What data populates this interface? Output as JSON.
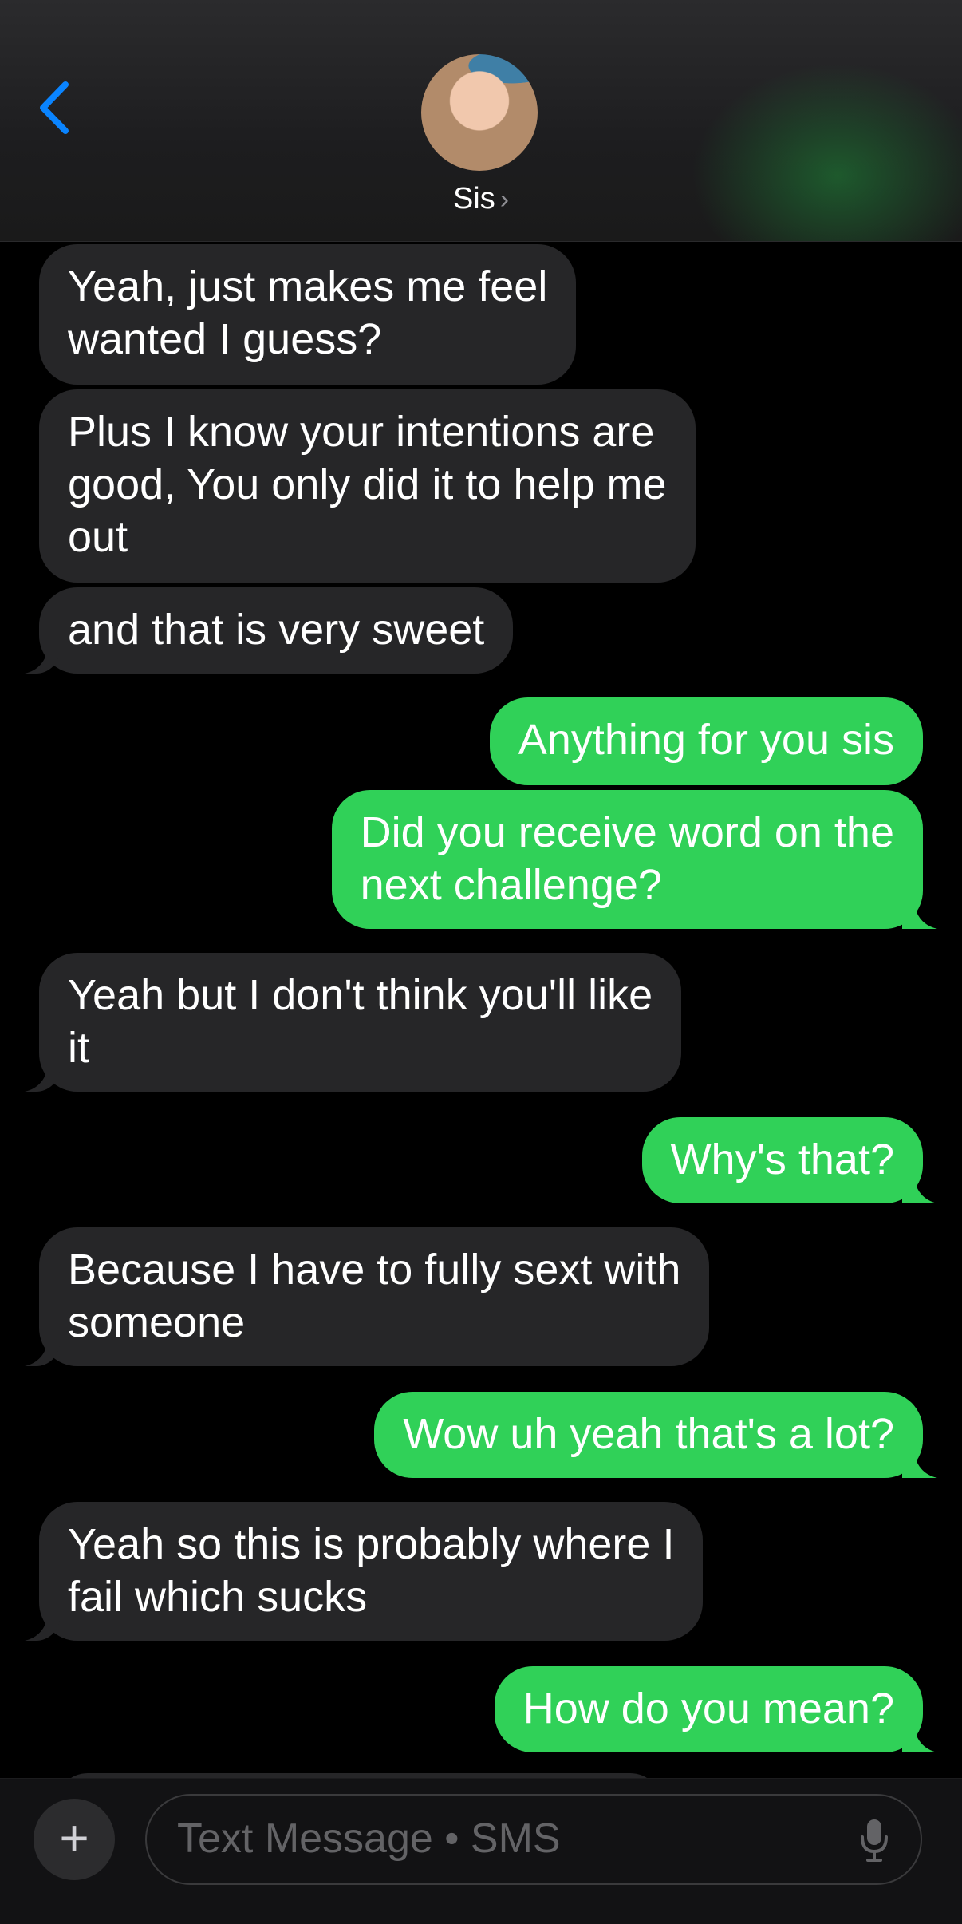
{
  "header": {
    "contact_name": "Sis",
    "chevron": "›"
  },
  "messages": [
    {
      "dir": "in",
      "text": "Yeah, just makes me feel\nwanted I guess?"
    },
    {
      "dir": "in",
      "text": "Plus I know your intentions are\ngood, You only did it to help me\nout"
    },
    {
      "dir": "in",
      "text": "and that is very sweet"
    },
    {
      "dir": "out",
      "text": "Anything for you sis"
    },
    {
      "dir": "out",
      "text": "Did you receive word on the\nnext challenge?"
    },
    {
      "dir": "in",
      "text": "Yeah but I don't think you'll like\nit"
    },
    {
      "dir": "out",
      "text": "Why's that?"
    },
    {
      "dir": "in",
      "text": "Because I have to fully sext with\nsomeone"
    },
    {
      "dir": "out",
      "text": "Wow uh yeah that's a lot?"
    },
    {
      "dir": "in",
      "text": "Yeah so this is probably where I\nfail which sucks"
    },
    {
      "dir": "out",
      "text": "How do you mean?"
    }
  ],
  "composer": {
    "plus": "+",
    "placeholder": "Text Message • SMS"
  },
  "colors": {
    "accent": "#0a84ff",
    "outgoing": "#30d158",
    "incoming": "#262628"
  }
}
